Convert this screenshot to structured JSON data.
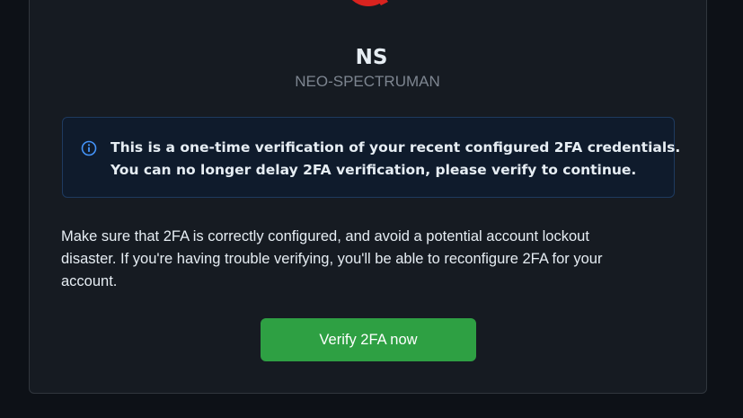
{
  "org": {
    "name": "NS",
    "login": "NEO-SPECTRUMAN"
  },
  "notice": {
    "icon": "info-icon",
    "line1": "This is a one-time verification of your recent configured 2FA credentials.",
    "line2": "You can no longer delay 2FA verification, please verify to continue."
  },
  "body": {
    "line1": "Make sure that 2FA is correctly configured, and avoid a potential account lockout",
    "line2": "disaster. If you're having trouble verifying, you'll be able to reconfigure 2FA for your",
    "line3": "account."
  },
  "actions": {
    "verify_label": "Verify 2FA now"
  },
  "colors": {
    "background": "#0d1117",
    "card": "#161b22",
    "notice_bg": "#0f1b2c",
    "notice_border": "#1e3a5f",
    "info_accent": "#4493f8",
    "button": "#2ea043",
    "logo_red": "#d9231f"
  }
}
